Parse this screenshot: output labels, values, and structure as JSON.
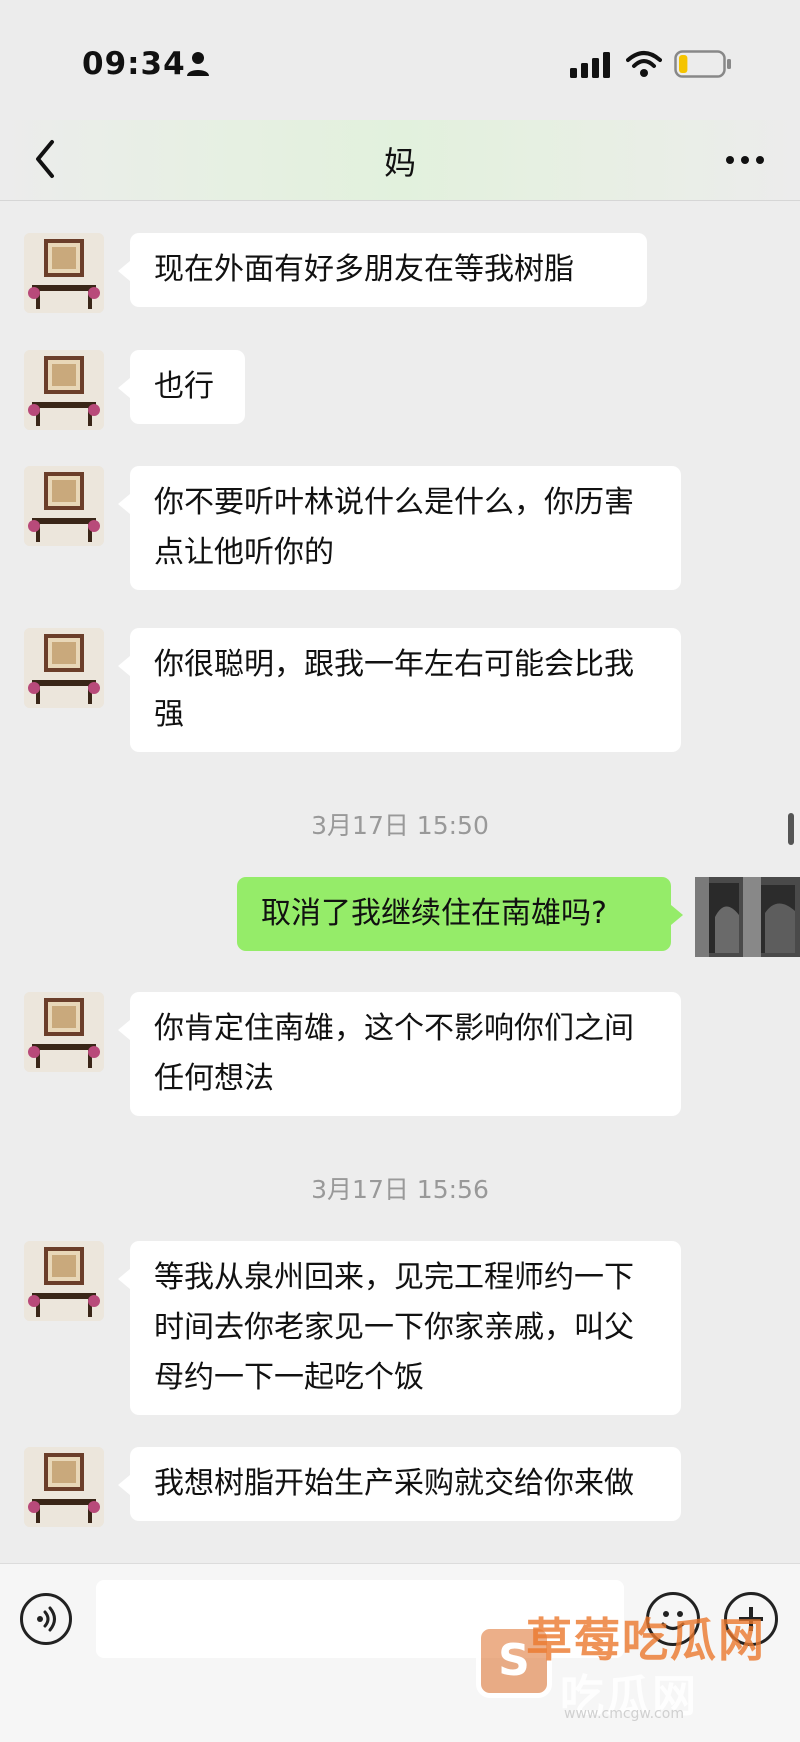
{
  "status_bar": {
    "time": "09:34",
    "battery_level": 0.2,
    "battery_color": "#f5c400"
  },
  "header": {
    "title": "妈"
  },
  "messages": [
    {
      "text": "现在外面有好多朋友在等我树脂"
    },
    {
      "text": "也行"
    },
    {
      "text": "你不要听叶林说什么是什么，你历害点让他听你的"
    },
    {
      "text": "你很聪明，跟我一年左右可能会比我强"
    },
    {
      "timestamp": "3月17日 15:50"
    },
    {
      "text": "取消了我继续住在南雄吗?"
    },
    {
      "text": "你肯定住南雄，这个不影响你们之间任何想法"
    },
    {
      "timestamp": "3月17日 15:56"
    },
    {
      "text": "等我从泉州回来，见完工程师约一下时间去你老家见一下你家亲戚，叫父母约一下一起吃个饭"
    },
    {
      "text": "我想树脂开始生产采购就交给你来做"
    }
  ],
  "colors": {
    "self_bubble": "#95ec69",
    "other_bubble": "#ffffff",
    "background": "#ededed"
  },
  "watermark": {
    "title": "草莓吃瓜网",
    "subtitle": "吃瓜网",
    "url": "www.cmcgw.com",
    "logo_letter": "S"
  }
}
